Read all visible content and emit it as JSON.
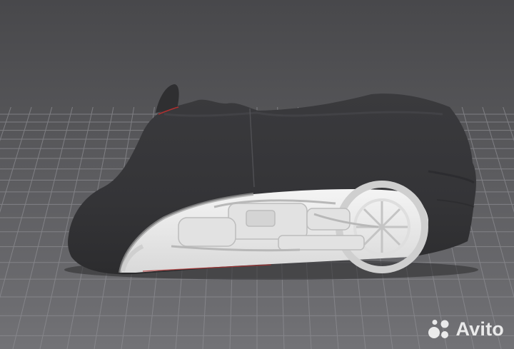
{
  "watermark": {
    "text": "Avito",
    "icon": "avito-logo-icon"
  },
  "colors": {
    "background_top": "#4e4e51",
    "background_bottom": "#707074",
    "grid_line": "#8a8a8e",
    "cover_fabric": "#353537",
    "cover_highlight": "#444447",
    "bike_body": "#f0f0f0",
    "bike_shadow": "#c8c8c8",
    "seam_accent": "#b03030"
  },
  "scene": {
    "subject": "motorcycle-cover-3d-render",
    "cover_state": "partially-covered"
  }
}
